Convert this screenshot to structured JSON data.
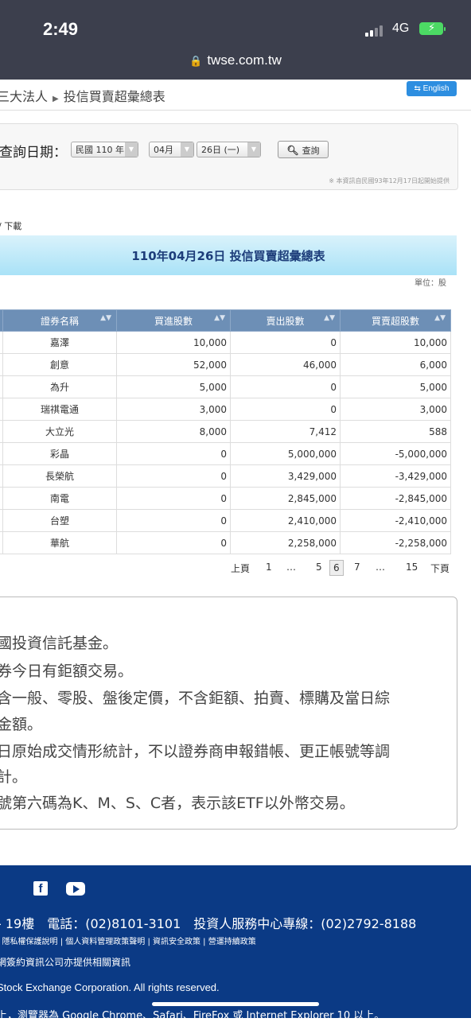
{
  "status": {
    "time": "2:49",
    "network": "4G"
  },
  "browser": {
    "url": "twse.com.tw"
  },
  "breadcrumb": {
    "parent": "三大法人",
    "current": "投信買賣超彙總表"
  },
  "english_label": "English",
  "query": {
    "label": "查詢日期：",
    "year": "民國 110 年",
    "month": "04月",
    "day": "26日 (一)",
    "button": "查詢",
    "note": "※ 本資訊自民國93年12月17日起開始提供"
  },
  "download_label": "/ 下載",
  "report": {
    "title": "110年04月26日 投信買賣超彙總表",
    "unit": "單位：股"
  },
  "table": {
    "headers": [
      "證券名稱",
      "買進股數",
      "賣出股數",
      "買賣超股數"
    ],
    "rows": [
      {
        "name": "嘉澤",
        "buy": "10,000",
        "sell": "0",
        "net": "10,000"
      },
      {
        "name": "創意",
        "buy": "52,000",
        "sell": "46,000",
        "net": "6,000"
      },
      {
        "name": "為升",
        "buy": "5,000",
        "sell": "0",
        "net": "5,000"
      },
      {
        "name": "瑞祺電通",
        "buy": "3,000",
        "sell": "0",
        "net": "3,000"
      },
      {
        "name": "大立光",
        "buy": "8,000",
        "sell": "7,412",
        "net": "588"
      },
      {
        "name": "彩晶",
        "buy": "0",
        "sell": "5,000,000",
        "net": "-5,000,000"
      },
      {
        "name": "長榮航",
        "buy": "0",
        "sell": "3,429,000",
        "net": "-3,429,000"
      },
      {
        "name": "南電",
        "buy": "0",
        "sell": "2,845,000",
        "net": "-2,845,000"
      },
      {
        "name": "台塑",
        "buy": "0",
        "sell": "2,410,000",
        "net": "-2,410,000"
      },
      {
        "name": "華航",
        "buy": "0",
        "sell": "2,258,000",
        "net": "-2,258,000"
      }
    ]
  },
  "pager": {
    "prev": "上頁",
    "p1": "1",
    "dots1": "…",
    "p5": "5",
    "current": "6",
    "p7": "7",
    "dots2": "…",
    "p15": "15",
    "next": "下頁"
  },
  "notes": [
    "國投資信託基金。",
    "券今日有鉅額交易。",
    "含一般、零股、盤後定價，不含鉅額、拍賣、標購及當日綜",
    "金額。",
    "日原始成交情形統計，不以證券商申報錯帳、更正帳號等調",
    "計。",
    "號第六碼為K、M、S、C者，表示該ETF以外幣交易。"
  ],
  "footer": {
    "address": "- 19樓　電話：(02)8101-3101　投資人服務中心專線：(02)2792-8188",
    "links": "| 隱私權保護說明 | 個人資料管理政策聲明 | 資訊安全政策 | 營運持續政策",
    "info": "網簽約資訊公司亦提供相關資訊",
    "copyright": "Stock Exchange Corporation. All rights reserved.",
    "browser": "上，瀏覽器為 Google Chrome、Safari、FireFox 或 Internet Explorer 10 以上。"
  }
}
